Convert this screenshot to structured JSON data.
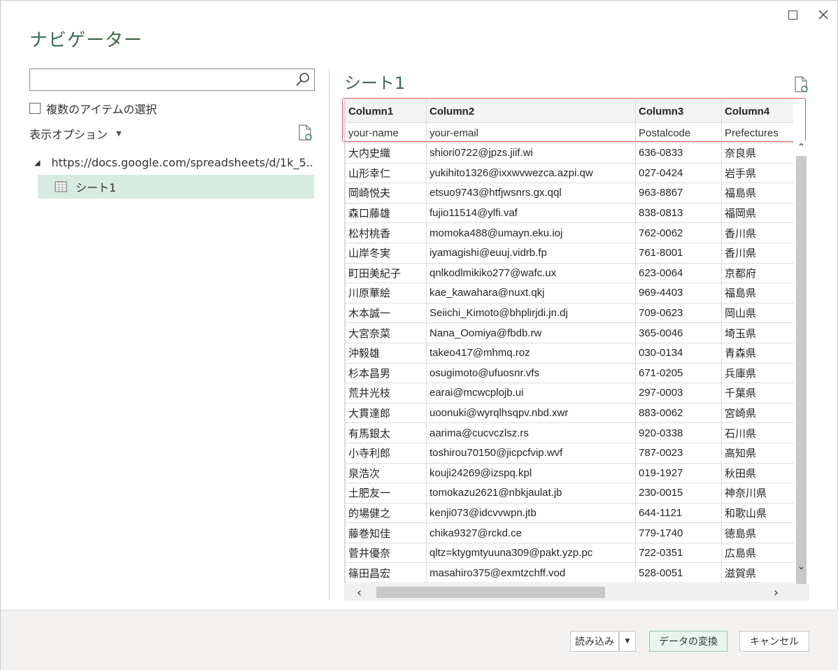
{
  "window": {
    "title": "ナビゲーター",
    "maximize_icon": "maximize-icon",
    "close_icon": "close-icon"
  },
  "left_pane": {
    "search": {
      "value": "",
      "placeholder": ""
    },
    "multi_select_label": "複数のアイテムの選択",
    "display_options_label": "表示オプション",
    "tree": {
      "folder_label": "https://docs.google.com/spreadsheets/d/1k_5...",
      "sheet_label": "シート1"
    }
  },
  "preview": {
    "title": "シート1",
    "columns": [
      "Column1",
      "Column2",
      "Column3",
      "Column4"
    ],
    "header_row": [
      "your-name",
      "your-email",
      "Postalcode",
      "Prefectures"
    ],
    "rows": [
      [
        "大内史織",
        "shiori0722@jpzs.jiif.wi",
        "636-0833",
        "奈良県"
      ],
      [
        "山形幸仁",
        "yukihito1326@ixxwvwezca.azpi.qw",
        "027-0424",
        "岩手県"
      ],
      [
        "岡崎悦夫",
        "etsuo9743@htfjwsnrs.gx.qql",
        "963-8867",
        "福島県"
      ],
      [
        "森口藤雄",
        "fujio11514@ylfi.vaf",
        "838-0813",
        "福岡県"
      ],
      [
        "松村桃香",
        "momoka488@umayn.eku.ioj",
        "762-0062",
        "香川県"
      ],
      [
        "山岸冬実",
        "iyamagishi@euuj.vidrb.fp",
        "761-8001",
        "香川県"
      ],
      [
        "町田美紀子",
        "qnlkodlmikiko277@wafc.ux",
        "623-0064",
        "京都府"
      ],
      [
        "川原華絵",
        "kae_kawahara@nuxt.qkj",
        "969-4403",
        "福島県"
      ],
      [
        "木本誠一",
        "Seiichi_Kimoto@bhplirjdi.jn.dj",
        "709-0623",
        "岡山県"
      ],
      [
        "大宮奈菜",
        "Nana_Oomiya@fbdb.rw",
        "365-0046",
        "埼玉県"
      ],
      [
        "沖毅雄",
        "takeo417@mhmq.roz",
        "030-0134",
        "青森県"
      ],
      [
        "杉本昌男",
        "osugimoto@ufuosnr.vfs",
        "671-0205",
        "兵庫県"
      ],
      [
        "荒井光枝",
        "earai@mcwcplojb.ui",
        "297-0003",
        "千葉県"
      ],
      [
        "大貫達郎",
        "uoonuki@wyrqlhsqpv.nbd.xwr",
        "883-0062",
        "宮崎県"
      ],
      [
        "有馬銀太",
        "aarima@cucvczlsz.rs",
        "920-0338",
        "石川県"
      ],
      [
        "小寺利郎",
        "toshirou70150@jicpcfvip.wvf",
        "787-0023",
        "高知県"
      ],
      [
        "泉浩次",
        "kouji24269@izspq.kpl",
        "019-1927",
        "秋田県"
      ],
      [
        "土肥友一",
        "tomokazu2621@nbkjaulat.jb",
        "230-0015",
        "神奈川県"
      ],
      [
        "的場健之",
        "kenji073@idcvvwpn.jtb",
        "644-1121",
        "和歌山県"
      ],
      [
        "藤巻知佳",
        "chika9327@rckd.ce",
        "779-1740",
        "徳島県"
      ],
      [
        "菅井優奈",
        "qltz=ktygmtyuuna309@pakt.yzp.pc",
        "722-0351",
        "広島県"
      ],
      [
        "篠田昌宏",
        "masahiro375@exmtzchff.vod",
        "528-0051",
        "滋賀県"
      ]
    ]
  },
  "footer": {
    "load_label": "読み込み",
    "transform_label": "データの変換",
    "cancel_label": "キャンセル"
  },
  "colors": {
    "accent_green": "#3b6b4b",
    "selected_bg": "#d7ebe0",
    "highlight_frame": "#d9534f"
  }
}
